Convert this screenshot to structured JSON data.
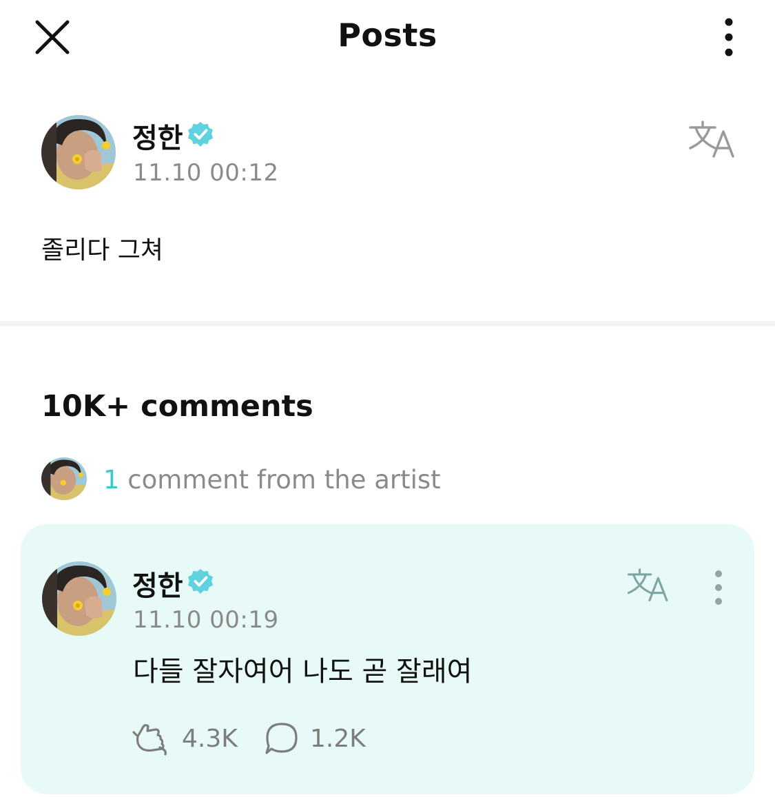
{
  "header": {
    "title": "Posts",
    "close_icon": "close-icon",
    "more_icon": "more-vertical-icon"
  },
  "post": {
    "author": "정한",
    "verified_icon": "verified-badge-icon",
    "timestamp": "11.10 00:12",
    "translate_icon": "translate-icon",
    "text": "졸리다 그쳐"
  },
  "comments": {
    "count_label": "10K+ comments",
    "artist_count": "1",
    "artist_label": " comment from the artist",
    "items": [
      {
        "author": "정한",
        "timestamp": "11.10 00:19",
        "text": "다들 잘자여어 나도 곧 잘래여",
        "likes": "4.3K",
        "replies": "1.2K"
      }
    ]
  },
  "colors": {
    "accent": "#3fc7c7",
    "card_bg": "#e7faf8",
    "muted_text": "#8a8a8a",
    "verified": "#5ed3df"
  }
}
